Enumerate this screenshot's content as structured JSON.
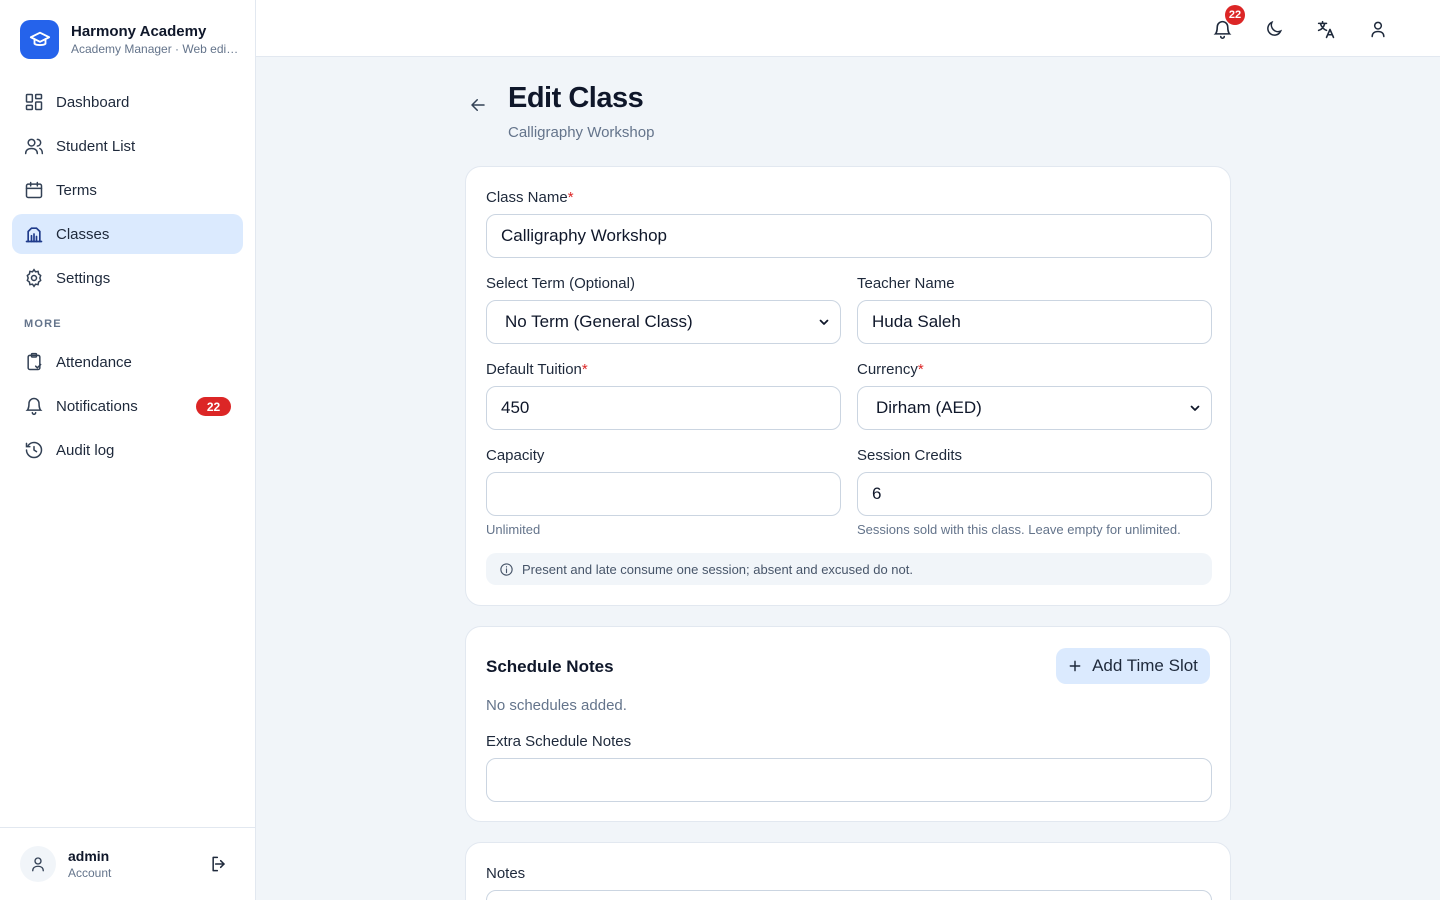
{
  "brand": {
    "name": "Harmony Academy",
    "subtitle": "Academy Manager · Web edition"
  },
  "sidebar": {
    "items": [
      {
        "label": "Dashboard",
        "icon": "dashboard-icon"
      },
      {
        "label": "Student List",
        "icon": "users-icon"
      },
      {
        "label": "Terms",
        "icon": "calendar-icon"
      },
      {
        "label": "Classes",
        "icon": "building-icon",
        "active": true
      },
      {
        "label": "Settings",
        "icon": "gear-icon"
      }
    ],
    "more_label": "MORE",
    "more_items": [
      {
        "label": "Attendance",
        "icon": "clipboard-icon"
      },
      {
        "label": "Notifications",
        "icon": "bell-icon",
        "badge": "22"
      },
      {
        "label": "Audit log",
        "icon": "history-icon"
      }
    ]
  },
  "account": {
    "name": "admin",
    "role": "Account"
  },
  "topbar": {
    "notification_count": "22",
    "icons": [
      "bell-icon",
      "moon-icon",
      "translate-icon",
      "user-icon"
    ]
  },
  "page": {
    "title": "Edit Class",
    "subtitle": "Calligraphy Workshop"
  },
  "form": {
    "class_name_label": "Class Name",
    "class_name_value": "Calligraphy Workshop",
    "term_label": "Select Term (Optional)",
    "term_value": "No Term (General Class)",
    "teacher_label": "Teacher Name",
    "teacher_value": "Huda Saleh",
    "tuition_label": "Default Tuition",
    "tuition_value": "450",
    "currency_label": "Currency",
    "currency_value": "Dirham (AED)",
    "capacity_label": "Capacity",
    "capacity_value": "",
    "capacity_hint": "Unlimited",
    "credits_label": "Session Credits",
    "credits_value": "6",
    "credits_hint": "Sessions sold with this class. Leave empty for unlimited.",
    "info_text": "Present and late consume one session; absent and excused do not.",
    "required_mark": "*"
  },
  "schedule": {
    "title": "Schedule Notes",
    "add_label": "Add Time Slot",
    "empty_text": "No schedules added.",
    "extra_label": "Extra Schedule Notes",
    "extra_value": ""
  },
  "notes": {
    "label": "Notes"
  },
  "colors": {
    "accent": "#2563eb",
    "active_bg": "#dbeafe",
    "badge": "#dc2626",
    "page_bg": "#f1f5f9"
  }
}
